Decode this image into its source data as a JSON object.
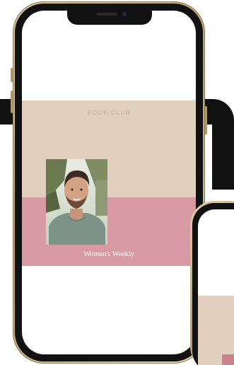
{
  "screen": {
    "section_label": "BOOK CLUB",
    "brand_logo": "Women's Weekly"
  },
  "colors": {
    "beige": "#e1d0bd",
    "pink": "#d79aa3",
    "label_pink": "#d2a3a7",
    "phone_gold": "#b99e6d"
  },
  "icons": {
    "notch": "notch-icon",
    "camera": "camera-icon"
  }
}
